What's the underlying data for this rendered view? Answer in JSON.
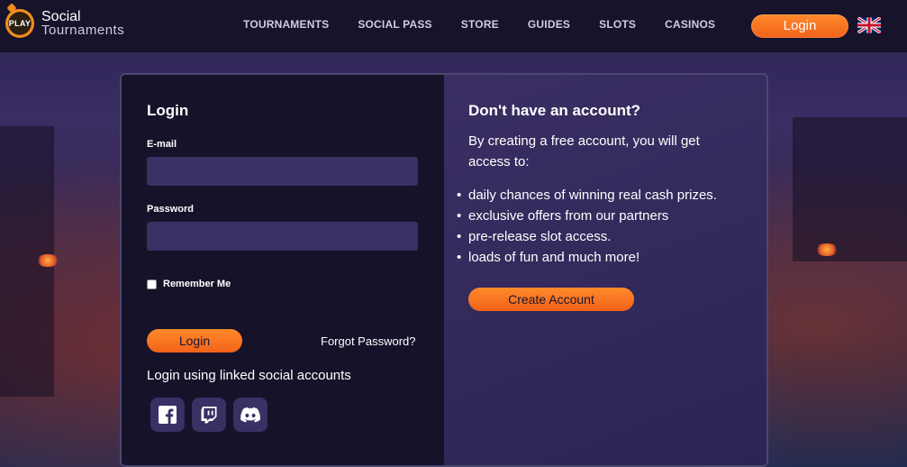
{
  "header": {
    "logo": {
      "badge_text": "PLAY",
      "line1": "Social",
      "line2": "Tournaments"
    },
    "nav": [
      {
        "label": "TOURNAMENTS"
      },
      {
        "label": "SOCIAL PASS"
      },
      {
        "label": "STORE"
      },
      {
        "label": "GUIDES"
      },
      {
        "label": "SLOTS"
      },
      {
        "label": "CASINOS"
      }
    ],
    "login_label": "Login",
    "language_icon": "uk-flag-icon"
  },
  "login_panel": {
    "title": "Login",
    "email_label": "E-mail",
    "email_value": "",
    "password_label": "Password",
    "password_value": "",
    "remember_label": "Remember Me",
    "remember_checked": false,
    "login_button": "Login",
    "forgot_link": "Forgot Password?",
    "social_title": "Login using linked social accounts",
    "social_icons": [
      "facebook-icon",
      "twitch-icon",
      "discord-icon"
    ]
  },
  "register_panel": {
    "title": "Don't have an account?",
    "description": "By creating a free account, you will get access to:",
    "benefits": [
      "daily chances of winning real cash prizes.",
      "exclusive offers from our partners",
      "pre-release slot access.",
      "loads of fun and much more!"
    ],
    "create_button": "Create Account"
  },
  "colors": {
    "accent": "#f5731f",
    "header_bg": "#17132b",
    "panel_left_bg": "#15122a",
    "panel_right_bg": "#342a5d",
    "input_bg": "#3a3063"
  }
}
